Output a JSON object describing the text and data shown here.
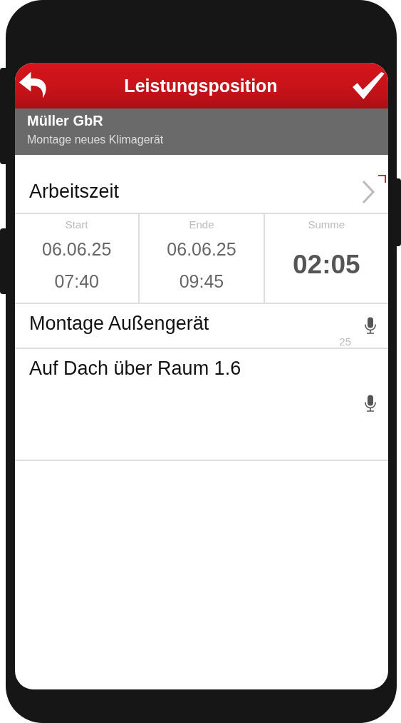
{
  "header": {
    "title": "Leistungsposition"
  },
  "customer": {
    "name": "Müller GbR",
    "subtitle": "Montage neues Klimagerät"
  },
  "worktime": {
    "label": "Arbeitszeit",
    "columns": [
      {
        "kind": "range",
        "label": "Start",
        "date": "06.06.25",
        "time": "07:40"
      },
      {
        "kind": "range",
        "label": "Ende",
        "date": "06.06.25",
        "time": "09:45"
      },
      {
        "kind": "total",
        "label": "Summe",
        "value": "02:05"
      }
    ]
  },
  "fields": [
    {
      "kind": "single",
      "value": "Montage Außengerät",
      "counter": "25"
    },
    {
      "kind": "multi",
      "value": "Auf Dach über Raum 1.6"
    }
  ]
}
